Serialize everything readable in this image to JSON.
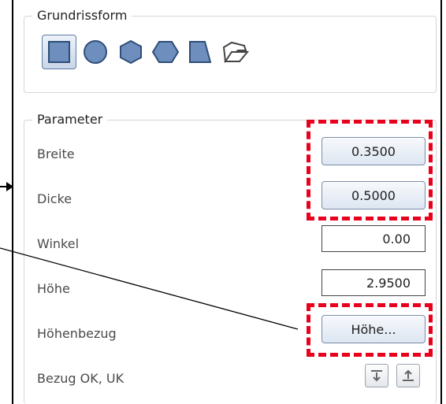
{
  "grundriss": {
    "title": "Grundrissform",
    "shapes": [
      "square-icon",
      "circle-icon",
      "hexagon-icon",
      "hexagon-horizontal-icon",
      "trapezoid-icon",
      "polygon-icon"
    ]
  },
  "parameter": {
    "title": "Parameter",
    "breite": {
      "label": "Breite",
      "value": "0.3500"
    },
    "dicke": {
      "label": "Dicke",
      "value": "0.5000"
    },
    "winkel": {
      "label": "Winkel",
      "value": "0.00"
    },
    "hoehe": {
      "label": "Höhe",
      "value": "2.9500"
    },
    "hoehenbezug": {
      "label": "Höhenbezug",
      "button": "Höhe..."
    },
    "bezug": {
      "label": "Bezug OK, UK"
    }
  },
  "colors": {
    "accent": "#5d7ca6",
    "highlight": "#e8001c"
  }
}
